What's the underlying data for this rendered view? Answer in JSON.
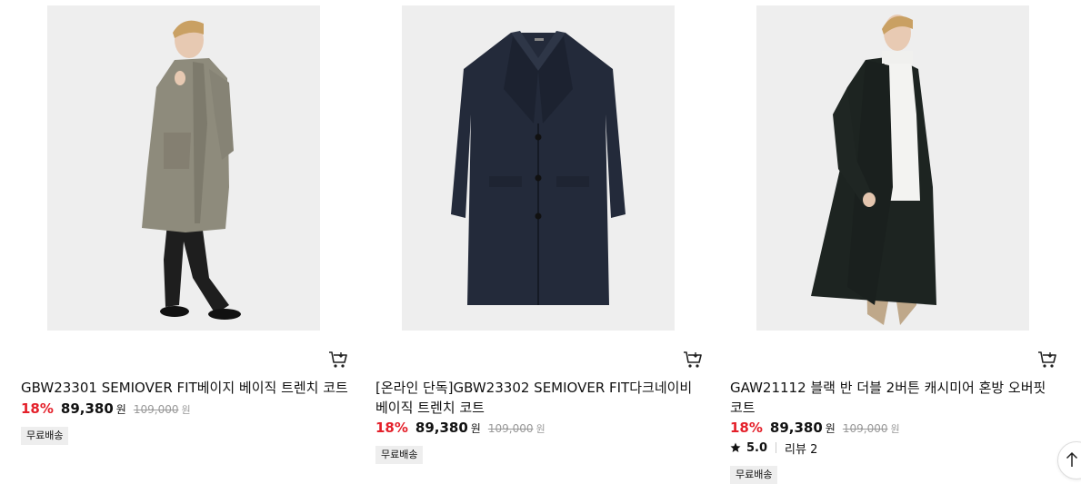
{
  "products": [
    {
      "image_alt": "beige trench coat on model",
      "name": "GBW23301 SEMIOVER FIT베이지 베이직 트렌치 코트",
      "discount": "18%",
      "sale_price": "89,380",
      "sale_unit": "원",
      "original_price": "109,000",
      "original_unit": "원",
      "badge": "무료배송",
      "cart_icon": "cart-icon"
    },
    {
      "image_alt": "dark navy trench coat flat",
      "name": "[온라인 단독]GBW23302 SEMIOVER FIT다크네이비 베이직 트렌치 코트",
      "discount": "18%",
      "sale_price": "89,380",
      "sale_unit": "원",
      "original_price": "109,000",
      "original_unit": "원",
      "badge": "무료배송",
      "cart_icon": "cart-icon"
    },
    {
      "image_alt": "black double cashmere blend over-fit coat on model",
      "name": "GAW21112 블랙 반 더블 2버튼 캐시미어 혼방 오버핏 코트",
      "discount": "18%",
      "sale_price": "89,380",
      "sale_unit": "원",
      "original_price": "109,000",
      "original_unit": "원",
      "rating": "5.0",
      "reviews": "리뷰 2",
      "badge": "무료배송",
      "cart_icon": "cart-icon"
    }
  ],
  "colors": {
    "discount": "#e4202a",
    "badge_bg": "#eeeeee",
    "image_bg": "#eeeeee"
  },
  "scroll_top_icon": "arrow-up-icon"
}
